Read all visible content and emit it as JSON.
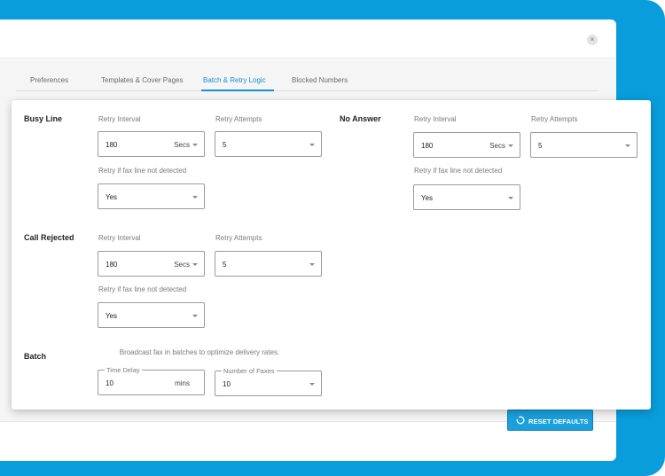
{
  "tabs": [
    {
      "label": "Preferences"
    },
    {
      "label": "Templates & Cover Pages"
    },
    {
      "label": "Batch & Retry Logic"
    },
    {
      "label": "Blocked Numbers"
    }
  ],
  "close_label": "×",
  "colors": {
    "accent": "#1a8fd0",
    "background": "#0a9ddb",
    "button": "#1aa0dd"
  },
  "busy_line": {
    "title": "Busy Line",
    "retry_interval_label": "Retry Interval",
    "retry_interval_value": "180",
    "retry_interval_unit": "Secs",
    "retry_attempts_label": "Retry Attempts",
    "retry_attempts_value": "5",
    "retry_if_label": "Retry if fax line not detected",
    "retry_if_value": "Yes"
  },
  "no_answer": {
    "title": "No Answer",
    "retry_interval_label": "Retry Interval",
    "retry_interval_value": "180",
    "retry_interval_unit": "Secs",
    "retry_attempts_label": "Retry Attempts",
    "retry_attempts_value": "5",
    "retry_if_label": "Retry if fax line not detected",
    "retry_if_value": "Yes"
  },
  "call_rejected": {
    "title": "Call Rejected",
    "retry_interval_label": "Retry Interval",
    "retry_interval_value": "180",
    "retry_interval_unit": "Secs",
    "retry_attempts_label": "Retry Attempts",
    "retry_attempts_value": "5",
    "retry_if_label": "Retry if fax line not detected",
    "retry_if_value": "Yes"
  },
  "batch": {
    "title": "Batch",
    "helper": "Broadcast fax in batches to optimize delivery rates.",
    "time_delay_label": "Time Delay",
    "time_delay_value": "10",
    "time_delay_unit": "mins",
    "num_faxes_label": "Number of Faxes",
    "num_faxes_value": "10"
  },
  "footer": {
    "reset_label": "RESET DEFAULTS",
    "reset_icon": "refresh-icon"
  }
}
